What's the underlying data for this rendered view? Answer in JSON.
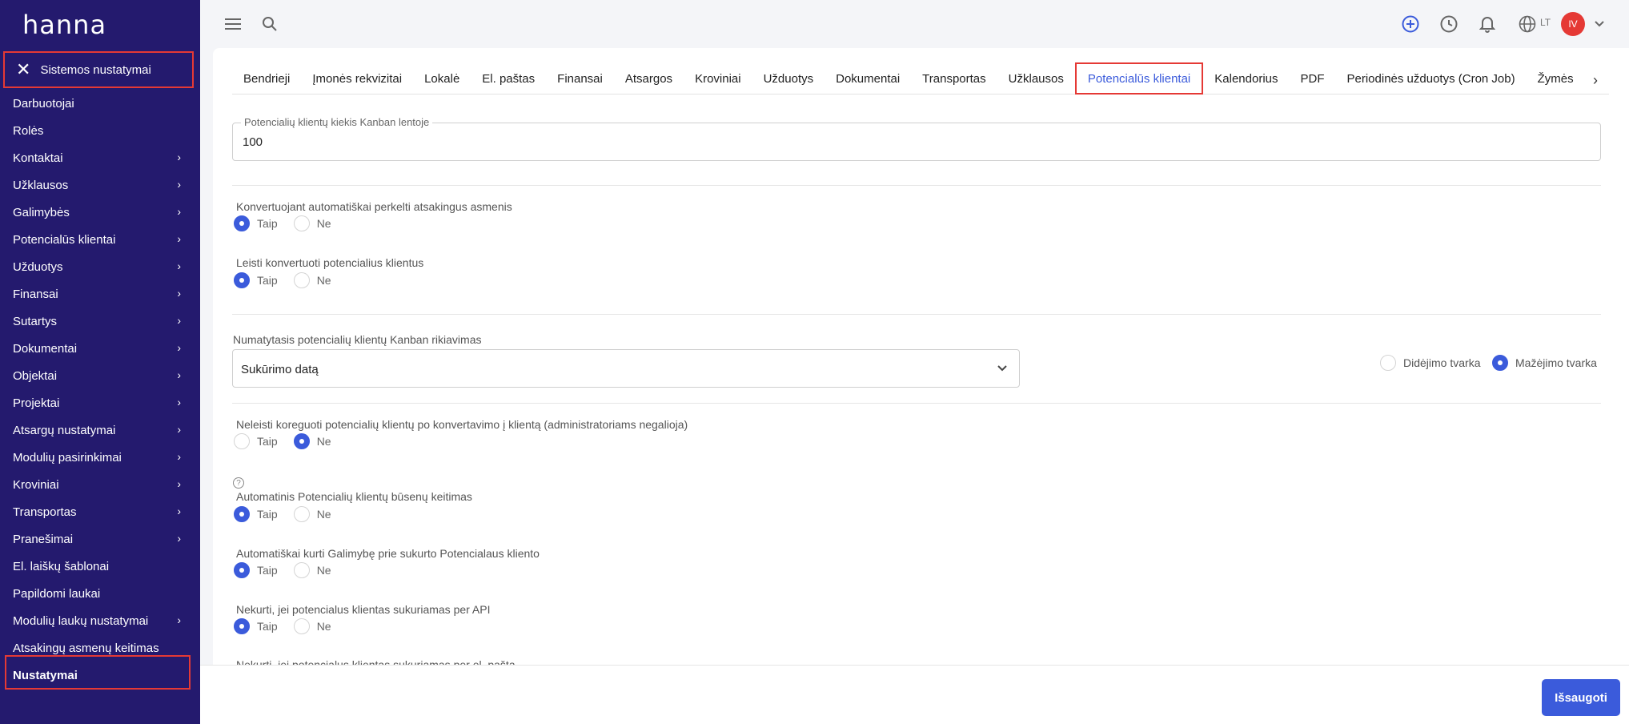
{
  "app": {
    "logo": "hanna"
  },
  "sidebar": {
    "header": "Sistemos nustatymai",
    "items": [
      {
        "label": "Darbuotojai",
        "chevron": false
      },
      {
        "label": "Rolės",
        "chevron": false
      },
      {
        "label": "Kontaktai",
        "chevron": true
      },
      {
        "label": "Užklausos",
        "chevron": true
      },
      {
        "label": "Galimybės",
        "chevron": true
      },
      {
        "label": "Potencialūs klientai",
        "chevron": true
      },
      {
        "label": "Užduotys",
        "chevron": true
      },
      {
        "label": "Finansai",
        "chevron": true
      },
      {
        "label": "Sutartys",
        "chevron": true
      },
      {
        "label": "Dokumentai",
        "chevron": true
      },
      {
        "label": "Objektai",
        "chevron": true
      },
      {
        "label": "Projektai",
        "chevron": true
      },
      {
        "label": "Atsargų nustatymai",
        "chevron": true
      },
      {
        "label": "Modulių pasirinkimai",
        "chevron": true
      },
      {
        "label": "Kroviniai",
        "chevron": true
      },
      {
        "label": "Transportas",
        "chevron": true
      },
      {
        "label": "Pranešimai",
        "chevron": true
      },
      {
        "label": "El. laiškų šablonai",
        "chevron": false
      },
      {
        "label": "Papildomi laukai",
        "chevron": false
      },
      {
        "label": "Modulių laukų nustatymai",
        "chevron": true
      },
      {
        "label": "Atsakingų asmenų keitimas",
        "chevron": false
      },
      {
        "label": "Nustatymai",
        "chevron": false
      }
    ]
  },
  "topbar": {
    "lang": "LT",
    "avatar_initials": "IV"
  },
  "tabs": [
    "Bendrieji",
    "Įmonės rekvizitai",
    "Lokalė",
    "El. paštas",
    "Finansai",
    "Atsargos",
    "Kroviniai",
    "Užduotys",
    "Dokumentai",
    "Transportas",
    "Užklausos",
    "Potencialūs klientai",
    "Kalendorius",
    "PDF",
    "Periodinės užduotys (Cron Job)",
    "Žymės"
  ],
  "active_tab": "Potencialūs klientai",
  "form": {
    "kanban_count": {
      "legend": "Potencialių klientų kiekis Kanban lentoje",
      "value": "100"
    },
    "q1": {
      "label": "Konvertuojant automatiškai perkelti atsakingus asmenis",
      "yes": "Taip",
      "no": "Ne",
      "selected": "yes"
    },
    "q2": {
      "label": "Leisti konvertuoti potencialius klientus",
      "yes": "Taip",
      "no": "Ne",
      "selected": "yes"
    },
    "sort": {
      "label": "Numatytasis potencialių klientų Kanban rikiavimas",
      "value": "Sukūrimo datą",
      "asc": "Didėjimo tvarka",
      "desc": "Mažėjimo tvarka",
      "order_selected": "desc"
    },
    "q3": {
      "label": "Neleisti koreguoti potencialių klientų po konvertavimo į klientą (administratoriams negalioja)",
      "yes": "Taip",
      "no": "Ne",
      "selected": "no"
    },
    "q4": {
      "label": "Automatinis Potencialių klientų būsenų keitimas",
      "yes": "Taip",
      "no": "Ne",
      "selected": "yes"
    },
    "q5": {
      "label": "Automatiškai kurti Galimybę prie sukurto Potencialaus kliento",
      "yes": "Taip",
      "no": "Ne",
      "selected": "yes"
    },
    "q6": {
      "label": "Nekurti, jei potencialus klientas sukuriamas per API",
      "yes": "Taip",
      "no": "Ne",
      "selected": "yes"
    },
    "q7": {
      "label": "Nekurti, jei potencialus klientas sukuriamas per el. paštą"
    }
  },
  "footer": {
    "save_label": "Išsaugoti"
  }
}
